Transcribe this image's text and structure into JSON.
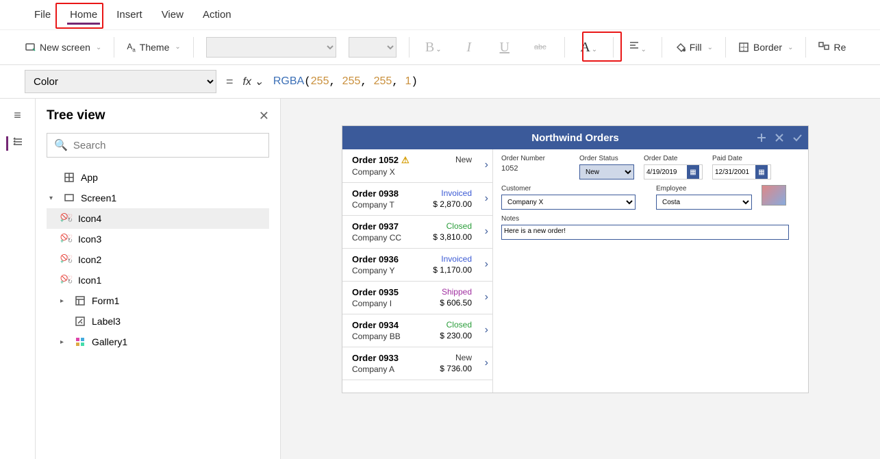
{
  "menu": {
    "file": "File",
    "home": "Home",
    "insert": "Insert",
    "view": "View",
    "action": "Action"
  },
  "ribbon": {
    "new_screen": "New screen",
    "theme": "Theme",
    "fill": "Fill",
    "border": "Border",
    "reorder": "Re"
  },
  "formula": {
    "property": "Color",
    "fn": "RGBA",
    "args": "255, 255, 255, 1"
  },
  "tree": {
    "title": "Tree view",
    "search_placeholder": "Search",
    "app": "App",
    "screen": "Screen1",
    "icon4": "Icon4",
    "icon3": "Icon3",
    "icon2": "Icon2",
    "icon1": "Icon1",
    "form1": "Form1",
    "label3": "Label3",
    "gallery1": "Gallery1"
  },
  "app": {
    "title": "Northwind Orders",
    "orders": [
      {
        "title": "Order 1052",
        "company": "Company X",
        "status": "New",
        "amount": "",
        "warn": true
      },
      {
        "title": "Order 0938",
        "company": "Company T",
        "status": "Invoiced",
        "amount": "$ 2,870.00"
      },
      {
        "title": "Order 0937",
        "company": "Company CC",
        "status": "Closed",
        "amount": "$ 3,810.00"
      },
      {
        "title": "Order 0936",
        "company": "Company Y",
        "status": "Invoiced",
        "amount": "$ 1,170.00"
      },
      {
        "title": "Order 0935",
        "company": "Company I",
        "status": "Shipped",
        "amount": "$ 606.50"
      },
      {
        "title": "Order 0934",
        "company": "Company BB",
        "status": "Closed",
        "amount": "$ 230.00"
      },
      {
        "title": "Order 0933",
        "company": "Company A",
        "status": "New",
        "amount": "$ 736.00"
      }
    ],
    "detail": {
      "order_number_lbl": "Order Number",
      "order_number": "1052",
      "order_status_lbl": "Order Status",
      "order_status": "New",
      "order_date_lbl": "Order Date",
      "order_date": "4/19/2019",
      "paid_date_lbl": "Paid Date",
      "paid_date": "12/31/2001",
      "customer_lbl": "Customer",
      "customer": "Company X",
      "employee_lbl": "Employee",
      "employee": "Costa",
      "notes_lbl": "Notes",
      "notes": "Here is a new order!"
    }
  }
}
